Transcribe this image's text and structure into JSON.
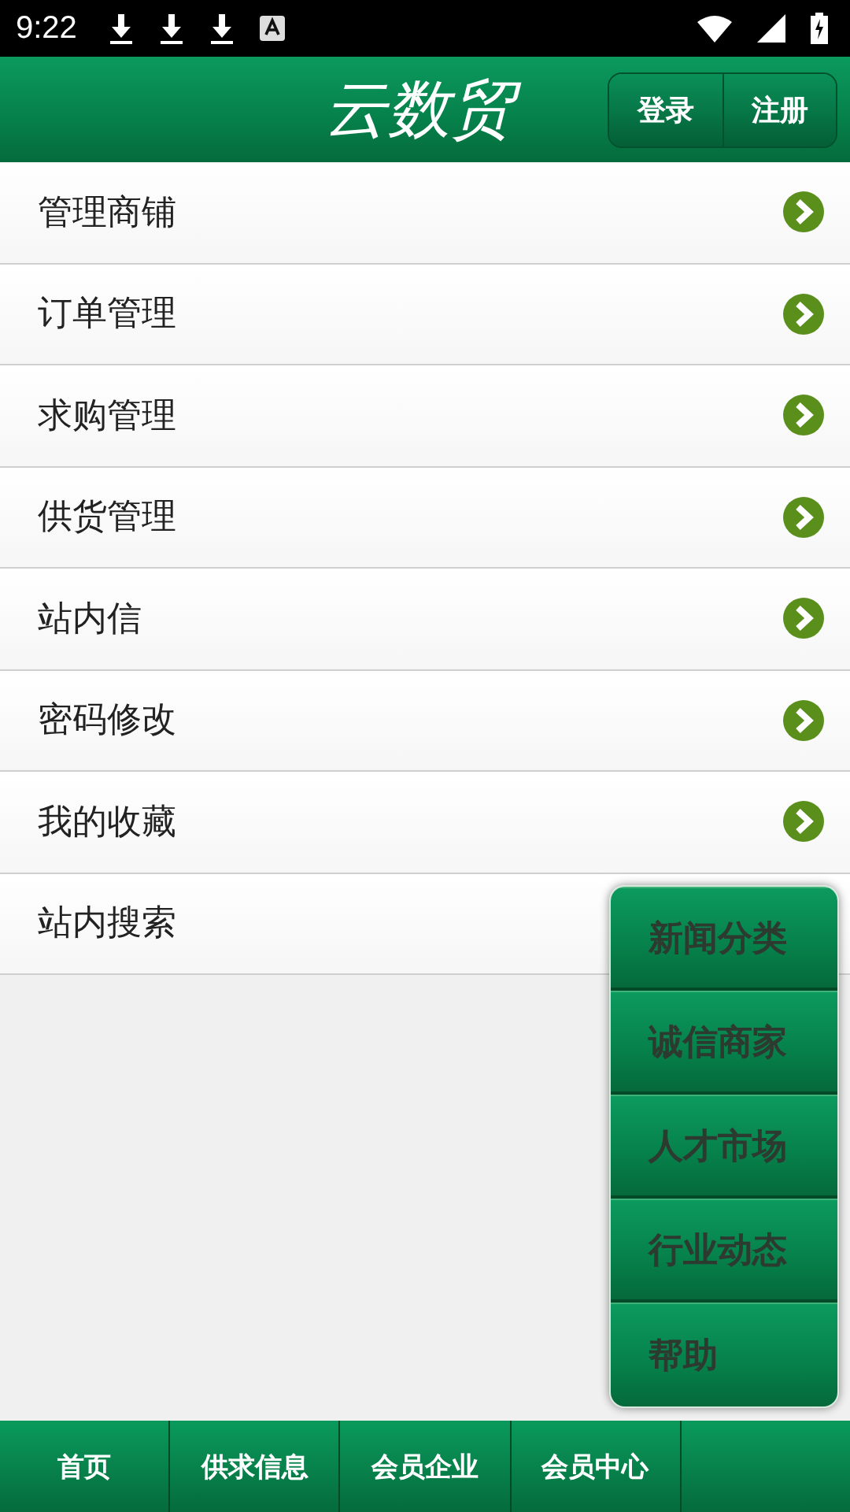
{
  "status_bar": {
    "time": "9:22"
  },
  "header": {
    "title": "云数贸",
    "buttons": [
      "登录",
      "注册"
    ]
  },
  "menu_items": [
    {
      "label": "管理商铺",
      "arrow": true
    },
    {
      "label": "订单管理",
      "arrow": true
    },
    {
      "label": "求购管理",
      "arrow": true
    },
    {
      "label": "供货管理",
      "arrow": true
    },
    {
      "label": "站内信",
      "arrow": true
    },
    {
      "label": "密码修改",
      "arrow": true
    },
    {
      "label": "我的收藏",
      "arrow": true
    },
    {
      "label": "站内搜索",
      "arrow": false
    }
  ],
  "popup_menu": [
    "新闻分类",
    "诚信商家",
    "人才市场",
    "行业动态",
    "帮助"
  ],
  "bottom_tabs": [
    {
      "kind": "text",
      "label": "首页"
    },
    {
      "kind": "text",
      "label": "供求信息"
    },
    {
      "kind": "text",
      "label": "会员企业"
    },
    {
      "kind": "text",
      "label": "会员中心"
    },
    {
      "kind": "blank"
    }
  ]
}
